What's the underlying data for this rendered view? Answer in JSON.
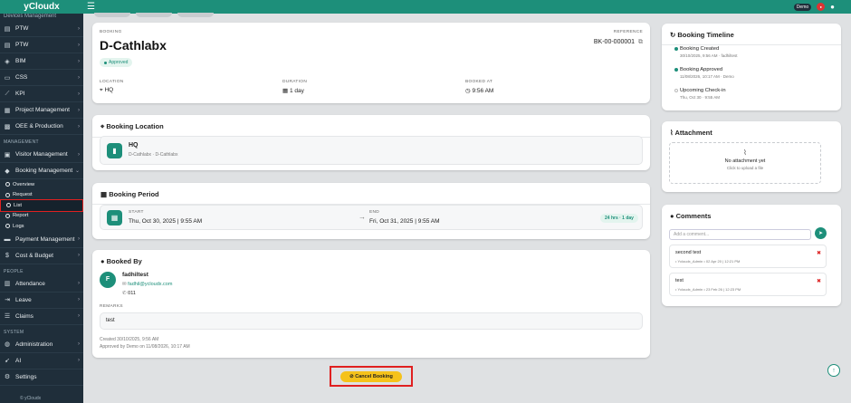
{
  "brand": "yCloudx",
  "topbar": {
    "demo_label": "Demo"
  },
  "sidebar": {
    "top_partial": "Devices Management",
    "items_top": [
      {
        "label": "PTW",
        "icon": "ptw-icon"
      },
      {
        "label": "PTW",
        "icon": "ptw-icon"
      },
      {
        "label": "BIM",
        "icon": "bim-icon"
      },
      {
        "label": "CSS",
        "icon": "css-icon"
      },
      {
        "label": "KPI",
        "icon": "kpi-icon"
      },
      {
        "label": "Project Management",
        "icon": "project-icon"
      },
      {
        "label": "OEE & Production",
        "icon": "oee-icon"
      }
    ],
    "section_management": "MANAGEMENT",
    "visitor": "Visitor Management",
    "booking": "Booking Management",
    "booking_sub": [
      "Overview",
      "Request",
      "List",
      "Report",
      "Logs"
    ],
    "payment": "Payment Management",
    "cost": "Cost & Budget",
    "section_people": "PEOPLE",
    "attendance": "Attendance",
    "leave": "Leave",
    "claims": "Claims",
    "section_system": "SYSTEM",
    "administration": "Administration",
    "ai": "AI",
    "settings": "Settings",
    "footer": "© yCloudx"
  },
  "booking": {
    "label": "BOOKING",
    "title": "D-Cathlabx",
    "status": "Approved",
    "reference_label": "REFERENCE",
    "reference": "BK-00-000001",
    "location_label": "LOCATION",
    "location": "HQ",
    "duration_label": "DURATION",
    "duration": "1 day",
    "booked_at_label": "BOOKED AT",
    "booked_at": "9:56 AM"
  },
  "location_card": {
    "title": "Booking Location",
    "name": "HQ",
    "path": "D-Cathlabx · D-Cathlabx"
  },
  "period_card": {
    "title": "Booking Period",
    "start_label": "START",
    "start": "Thu, Oct 30, 2025 | 9:55 AM",
    "end_label": "END",
    "end": "Fri, Oct 31, 2025 | 9:55 AM",
    "duration_chip": "24 hrs · 1 day"
  },
  "booked_by": {
    "title": "Booked By",
    "initial": "F",
    "name": "fadhiltest",
    "email": "fadhil@ycloudx.com",
    "phone": "011",
    "remarks_label": "REMARKS",
    "remarks": "test",
    "created": "Created 30/10/2025, 9:56 AM",
    "approved": "Approved by Demo on 11/08/2026, 10:17 AM"
  },
  "cancel_button": "Cancel Booking",
  "timeline": {
    "title": "Booking Timeline",
    "items": [
      {
        "title": "Booking Created",
        "sub": "30/10/2025, 9:56 AM · fadhiltest"
      },
      {
        "title": "Booking Approved",
        "sub": "11/08/2026, 10:17 AM · Demo"
      },
      {
        "title": "Upcoming Check-in",
        "sub": "Thu, Oct 30 · 9:55 AM"
      }
    ]
  },
  "attachment": {
    "title": "Attachment",
    "empty": "No attachment yet",
    "hint": "Click to upload a file"
  },
  "comments": {
    "title": "Comments",
    "placeholder": "Add a comment...",
    "items": [
      {
        "text": "second test",
        "meta": "• Ycloudx_Admin   • 02 Apr 20 | 12:21 PM"
      },
      {
        "text": "test",
        "meta": "• Ycloudx_Admin   • 23 Feb 26 | 12:23 PM"
      }
    ]
  }
}
